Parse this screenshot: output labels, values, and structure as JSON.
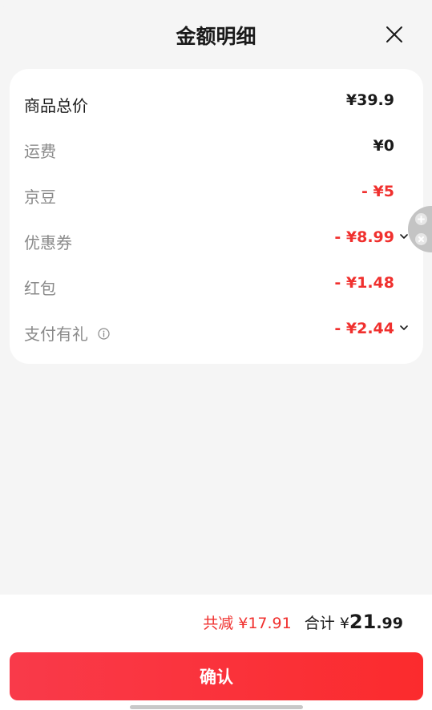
{
  "header": {
    "title": "金额明细"
  },
  "rows": [
    {
      "label": "商品总价",
      "value": "¥39.9"
    },
    {
      "label": "运费",
      "value": "¥0"
    },
    {
      "label": "京豆",
      "value": "- ¥5"
    },
    {
      "label": "优惠券",
      "value": "- ¥8.99"
    },
    {
      "label": "红包",
      "value": "- ¥1.48"
    },
    {
      "label": "支付有礼",
      "value": "- ¥2.44"
    }
  ],
  "footer": {
    "saved": "共减 ¥17.91",
    "total_label": "合计 ¥",
    "total_int": "21",
    "total_dec": ".99",
    "confirm_label": "确认"
  },
  "icons": {
    "close": "close-icon",
    "info": "info-icon",
    "chevron": "chevron-down-icon",
    "float_add": "plus-icon",
    "float_close": "close-icon"
  },
  "colors": {
    "accent_red": "#f0302e",
    "button_gradient_start": "#f93a4a",
    "button_gradient_end": "#fb2b2d"
  }
}
